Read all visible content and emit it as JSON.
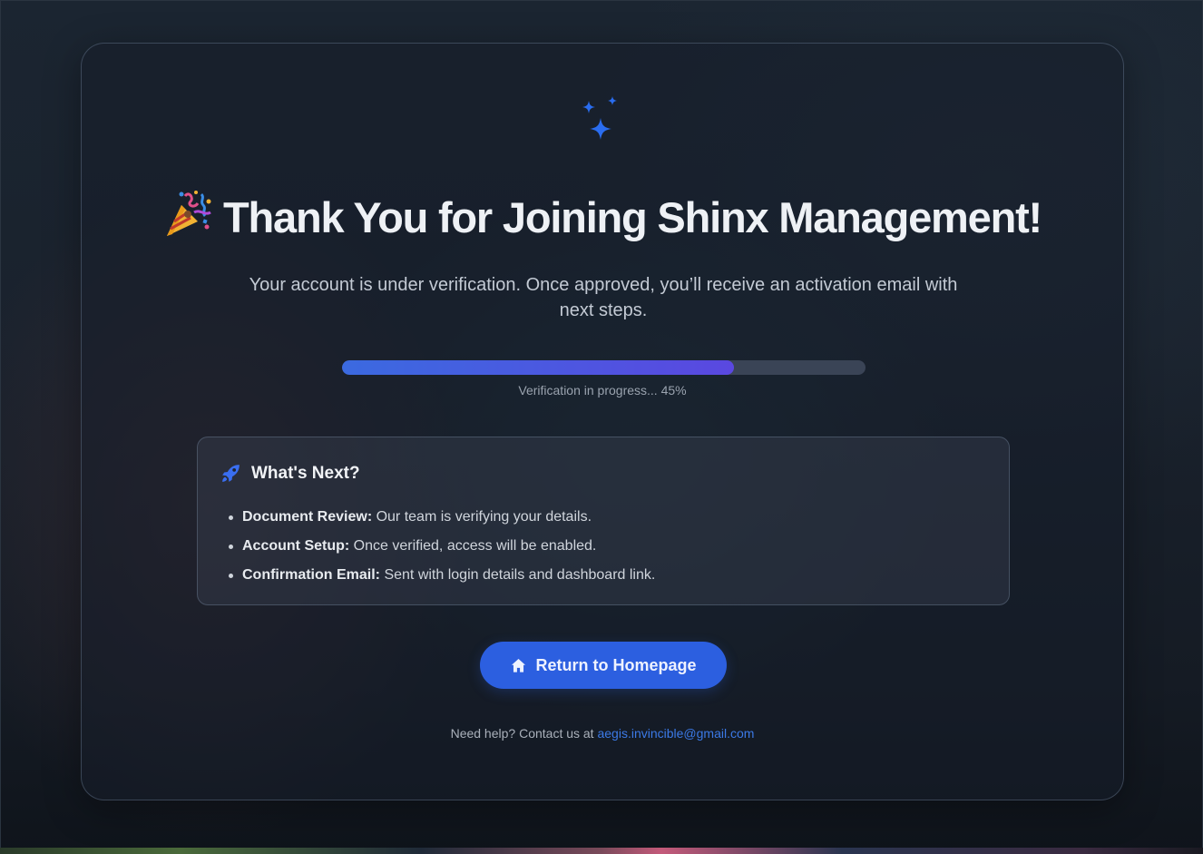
{
  "hero": {
    "title": "Thank You for Joining Shinx Management!",
    "subtitle": "Your account is under verification. Once approved, you’ll receive an activation email with next steps."
  },
  "progress": {
    "percent": 45,
    "label": "Verification in progress... 45%"
  },
  "whats_next": {
    "heading": "What's Next?",
    "items": [
      {
        "title": "Document Review:",
        "text": " Our team is verifying your details."
      },
      {
        "title": "Account Setup:",
        "text": " Once verified, access will be enabled."
      },
      {
        "title": "Confirmation Email:",
        "text": " Sent with login details and dashboard link."
      }
    ]
  },
  "cta": {
    "label": "Return to Homepage"
  },
  "help": {
    "prefix": "Need help? Contact us at ",
    "email": "aegis.invincible@gmail.com"
  },
  "icons": {
    "hero": "sparkles-icon",
    "title": "party-popper-icon",
    "whats_next": "rocket-icon",
    "cta": "home-icon"
  },
  "colors": {
    "accent": "#2c5fe0",
    "progress_start": "#3b6ae0",
    "progress_end": "#5a48e0",
    "link": "#3b79e6"
  }
}
